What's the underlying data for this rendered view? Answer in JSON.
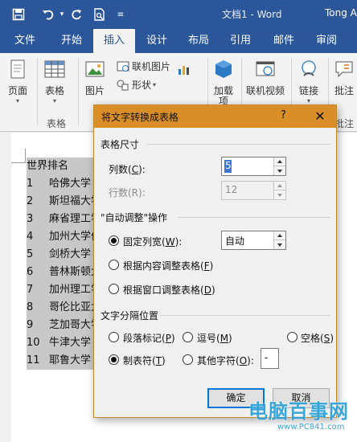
{
  "titlebar": {
    "doc_title": "文档1 - Word",
    "user_name": "Tong A"
  },
  "tabs": [
    {
      "label": "文件"
    },
    {
      "label": "开始"
    },
    {
      "label": "插入"
    },
    {
      "label": "设计"
    },
    {
      "label": "布局"
    },
    {
      "label": "引用"
    },
    {
      "label": "邮件"
    },
    {
      "label": "审阅"
    }
  ],
  "ribbon": {
    "page_label": "页面",
    "table_label": "表格",
    "table_group": "表格",
    "picture_label": "图片",
    "online_picture_label": "联机图片",
    "shapes_label": "形状",
    "addins_label": "加载",
    "addins_label2": "项",
    "online_video_label": "联机视频",
    "link_label": "链接",
    "comment_label": "批注",
    "comment_group": "批注"
  },
  "document": {
    "header": "世界排名",
    "rows": [
      {
        "num": "1",
        "name": "哈佛大学"
      },
      {
        "num": "2",
        "name": "斯坦福大学"
      },
      {
        "num": "3",
        "name": "麻省理工学院"
      },
      {
        "num": "4",
        "name": "加州大学伯克利分校"
      },
      {
        "num": "5",
        "name": "剑桥大学"
      },
      {
        "num": "6",
        "name": "普林斯顿大学"
      },
      {
        "num": "7",
        "name": "加州理工学院"
      },
      {
        "num": "8",
        "name": "哥伦比亚大学"
      },
      {
        "num": "9",
        "name": "芝加哥大学"
      },
      {
        "num": "10",
        "name": "牛津大学"
      },
      {
        "num": "11",
        "name": "耶鲁大学"
      }
    ]
  },
  "dialog": {
    "title": "将文字转换成表格",
    "help": "?",
    "close": "✕",
    "table_size_section": "表格尺寸",
    "columns_label_pre": "列数(",
    "columns_key": "C",
    "columns_label_post": "):",
    "columns_value": "5",
    "rows_label": "行数(R):",
    "rows_value": "12",
    "autofit_section": "\"自动调整\"操作",
    "fixed_width_pre": "固定列宽(",
    "fixed_width_key": "W",
    "fixed_width_post": "):",
    "fixed_width_value": "自动",
    "autofit_content_pre": "根据内容调整表格(",
    "autofit_content_key": "F",
    "autofit_content_post": ")",
    "autofit_window_pre": "根据窗口调整表格(",
    "autofit_window_key": "D",
    "autofit_window_post": ")",
    "separator_section": "文字分隔位置",
    "paragraph_pre": "段落标记(",
    "paragraph_key": "P",
    "paragraph_post": ")",
    "comma_pre": "逗号(",
    "comma_key": "M",
    "comma_post": ")",
    "space_pre": "空格(",
    "space_key": "S",
    "space_post": ")",
    "tab_pre": "制表符(",
    "tab_key": "T",
    "tab_post": ")",
    "other_pre": "其他字符(",
    "other_key": "O",
    "other_post": "):",
    "other_value": "-",
    "ok_label": "确定",
    "cancel_label": "取消"
  },
  "watermark": {
    "text": "电脑百事网",
    "url": "www.PC841.com"
  }
}
